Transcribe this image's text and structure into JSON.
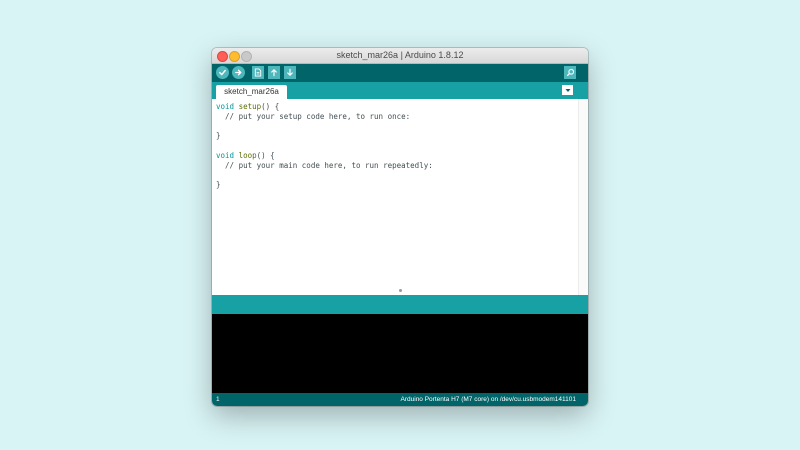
{
  "window": {
    "title": "sketch_mar26a | Arduino 1.8.12"
  },
  "toolbar": {
    "buttons": [
      {
        "name": "verify",
        "icon": "check-icon"
      },
      {
        "name": "upload",
        "icon": "arrow-right-icon"
      },
      {
        "name": "new",
        "icon": "new-file-icon"
      },
      {
        "name": "open",
        "icon": "arrow-up-icon"
      },
      {
        "name": "save",
        "icon": "arrow-down-icon"
      },
      {
        "name": "serial-monitor",
        "icon": "magnifier-icon"
      }
    ]
  },
  "tabs": {
    "active": "sketch_mar26a"
  },
  "editor": {
    "lines": [
      {
        "type": "void",
        "fn": "setup",
        "rest": "() {"
      },
      {
        "text": "  // put your setup code here, to run once:"
      },
      {
        "text": ""
      },
      {
        "text": "}"
      },
      {
        "text": ""
      },
      {
        "type": "void",
        "fn": "loop",
        "rest": "() {"
      },
      {
        "text": "  // put your main code here, to run repeatedly:"
      },
      {
        "text": ""
      },
      {
        "text": "}"
      }
    ]
  },
  "status": {
    "line_number": "1",
    "board": "Arduino Portenta H7 (M7 core) on /dev/cu.usbmodem141101"
  },
  "colors": {
    "toolbar": "#006468",
    "tabbar": "#17a1a5",
    "button": "#4db7bb",
    "console": "#000000",
    "background": "#d9f4f5"
  }
}
